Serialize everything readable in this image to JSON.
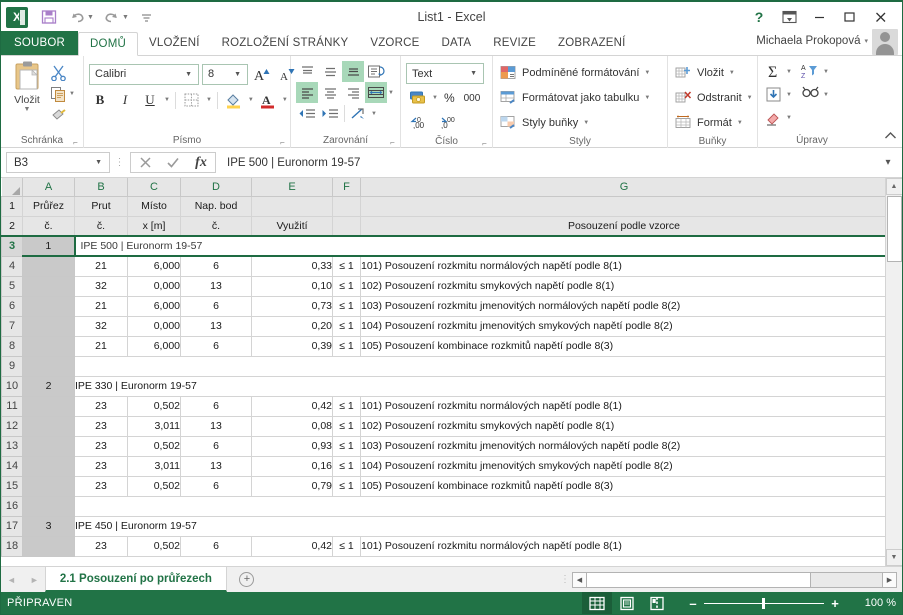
{
  "window": {
    "title": "List1 - Excel",
    "help_icon": "?",
    "ribbon_display_icon": "ribbon-display-options",
    "minimize_icon": "–",
    "restore_icon": "☐",
    "close_icon": "✕"
  },
  "qat": {
    "logo": "X",
    "save_icon": "save-icon",
    "undo_icon": "undo-icon",
    "redo_icon": "redo-icon",
    "customize_icon": "customize-icon"
  },
  "tabs": {
    "file": "SOUBOR",
    "items": [
      "DOMŮ",
      "VLOŽENÍ",
      "ROZLOŽENÍ STRÁNKY",
      "VZORCE",
      "DATA",
      "REVIZE",
      "ZOBRAZENÍ"
    ],
    "active": "DOMŮ"
  },
  "user": {
    "name": "Michaela Prokopová",
    "caret": "▾"
  },
  "ribbon": {
    "clipboard": {
      "label": "Schránka",
      "paste": "Vložit",
      "cut_icon": "scissors-icon",
      "copy_icon": "copy-icon",
      "format_painter_icon": "format-painter-icon",
      "launcher": "⌐"
    },
    "font": {
      "label": "Písmo",
      "family": "Calibri",
      "size": "8",
      "grow_icon": "A",
      "shrink_icon": "A",
      "bold": "B",
      "italic": "I",
      "underline": "U",
      "borders_icon": "borders-icon",
      "fill_icon": "fill-color-icon",
      "fontcolor_icon": "font-color-icon"
    },
    "alignment": {
      "label": "Zarovnání",
      "top": "align-top-icon",
      "middle": "align-middle-icon",
      "bottom": "align-bottom-icon",
      "orientation": "orientation-icon",
      "left": "align-left-icon",
      "center": "align-center-icon",
      "right": "align-right-icon",
      "wrap": "wrap-text-icon",
      "merge": "merge-cells-icon",
      "decrease_indent": "decrease-indent-icon",
      "increase_indent": "increase-indent-icon"
    },
    "number": {
      "label": "Číslo",
      "format": "Text",
      "accounting_icon": "accounting-format-icon",
      "percent": "%",
      "thousands": "000",
      "increase_decimal": "increase-decimal-icon",
      "decrease_decimal": "decrease-decimal-icon"
    },
    "styles": {
      "label": "Styly",
      "items": [
        "Podmíněné formátování",
        "Formátovat jako tabulku",
        "Styly buňky"
      ]
    },
    "cells": {
      "label": "Buňky",
      "items": [
        "Vložit",
        "Odstranit",
        "Formát"
      ]
    },
    "editing": {
      "label": "Úpravy",
      "sum_icon": "autosum-icon",
      "fill_icon": "fill-down-icon",
      "clear_icon": "clear-icon",
      "sort_icon": "sort-filter-icon",
      "find_icon": "find-select-icon"
    },
    "collapse_icon": "collapse-ribbon-icon"
  },
  "formula_bar": {
    "name_box": "B3",
    "cancel_icon": "✕",
    "enter_icon": "✓",
    "fx_icon": "fx",
    "content": "IPE 500 | Euronorm 19-57",
    "expand_icon": "▾"
  },
  "grid": {
    "columns": [
      "A",
      "B",
      "C",
      "D",
      "E",
      "F",
      "G"
    ],
    "header_rows": [
      {
        "num": "1",
        "A": "Průřez",
        "B": "Prut",
        "C": "Místo",
        "D": "Nap. bod",
        "E": "",
        "F": "",
        "G": ""
      },
      {
        "num": "2",
        "A": "č.",
        "B": "č.",
        "C": "x [m]",
        "D": "č.",
        "E": "Využití",
        "F": "",
        "G": "Posouzení podle vzorce"
      }
    ],
    "rows": [
      {
        "num": "3",
        "type": "section",
        "A": "1",
        "merged": "IPE 500 | Euronorm 19-57",
        "selected": true
      },
      {
        "num": "4",
        "type": "data",
        "A": "",
        "B": "21",
        "C": "6,000",
        "D": "6",
        "E": "0,33",
        "F": "≤ 1",
        "G": "101) Posouzení rozkmitu normálových napětí podle 8(1)"
      },
      {
        "num": "5",
        "type": "data",
        "A": "",
        "B": "32",
        "C": "0,000",
        "D": "13",
        "E": "0,10",
        "F": "≤ 1",
        "G": "102) Posouzení rozkmitu smykových napětí podle 8(1)"
      },
      {
        "num": "6",
        "type": "data",
        "A": "",
        "B": "21",
        "C": "6,000",
        "D": "6",
        "E": "0,73",
        "F": "≤ 1",
        "G": "103) Posouzení rozkmitu jmenovitých normálových napětí podle 8(2)"
      },
      {
        "num": "7",
        "type": "data",
        "A": "",
        "B": "32",
        "C": "0,000",
        "D": "13",
        "E": "0,20",
        "F": "≤ 1",
        "G": "104) Posouzení rozkmitu jmenovitých smykových napětí podle 8(2)"
      },
      {
        "num": "8",
        "type": "data",
        "A": "",
        "B": "21",
        "C": "6,000",
        "D": "6",
        "E": "0,39",
        "F": "≤ 1",
        "G": "105) Posouzení kombinace rozkmitů napětí podle 8(3)"
      },
      {
        "num": "9",
        "type": "empty",
        "A": "",
        "B": "",
        "C": "",
        "D": "",
        "E": "",
        "F": "",
        "G": ""
      },
      {
        "num": "10",
        "type": "section",
        "A": "2",
        "merged": "IPE 330 | Euronorm 19-57"
      },
      {
        "num": "11",
        "type": "data",
        "A": "",
        "B": "23",
        "C": "0,502",
        "D": "6",
        "E": "0,42",
        "F": "≤ 1",
        "G": "101) Posouzení rozkmitu normálových napětí podle 8(1)"
      },
      {
        "num": "12",
        "type": "data",
        "A": "",
        "B": "23",
        "C": "3,011",
        "D": "13",
        "E": "0,08",
        "F": "≤ 1",
        "G": "102) Posouzení rozkmitu smykových napětí podle 8(1)"
      },
      {
        "num": "13",
        "type": "data",
        "A": "",
        "B": "23",
        "C": "0,502",
        "D": "6",
        "E": "0,93",
        "F": "≤ 1",
        "G": "103) Posouzení rozkmitu jmenovitých normálových napětí podle 8(2)"
      },
      {
        "num": "14",
        "type": "data",
        "A": "",
        "B": "23",
        "C": "3,011",
        "D": "13",
        "E": "0,16",
        "F": "≤ 1",
        "G": "104) Posouzení rozkmitu jmenovitých smykových napětí podle 8(2)"
      },
      {
        "num": "15",
        "type": "data",
        "A": "",
        "B": "23",
        "C": "0,502",
        "D": "6",
        "E": "0,79",
        "F": "≤ 1",
        "G": "105) Posouzení kombinace rozkmitů napětí podle 8(3)"
      },
      {
        "num": "16",
        "type": "empty",
        "A": "",
        "B": "",
        "C": "",
        "D": "",
        "E": "",
        "F": "",
        "G": ""
      },
      {
        "num": "17",
        "type": "section",
        "A": "3",
        "merged": "IPE 450 | Euronorm 19-57"
      },
      {
        "num": "18",
        "type": "data",
        "A": "",
        "B": "23",
        "C": "0,502",
        "D": "6",
        "E": "0,42",
        "F": "≤ 1",
        "G": "101) Posouzení rozkmitu normálových napětí podle 8(1)"
      }
    ]
  },
  "sheet_tabs": {
    "prev_icon": "◄",
    "next_icon": "►",
    "active": "2.1 Posouzení po průřezech",
    "add": "+"
  },
  "status_bar": {
    "state": "PŘIPRAVEN",
    "view_normal_icon": "normal-view-icon",
    "view_layout_icon": "page-layout-icon",
    "view_break_icon": "page-break-icon",
    "zoom_out": "–",
    "zoom_in": "+",
    "zoom_level": "100 %"
  }
}
